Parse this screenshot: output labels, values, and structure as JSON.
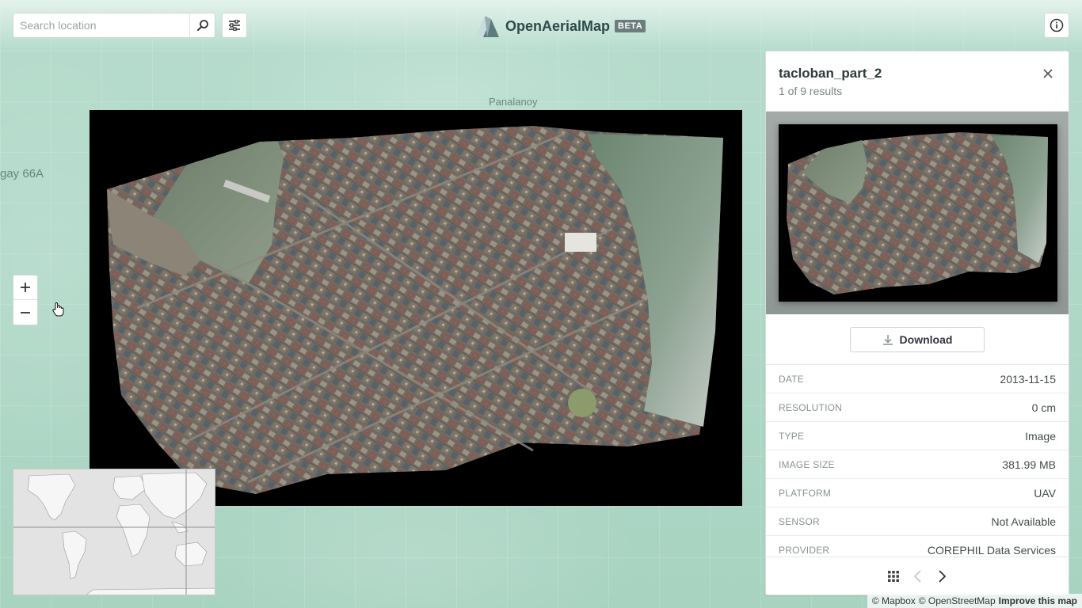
{
  "header": {
    "search": {
      "placeholder": "Search location",
      "value": ""
    },
    "brand": {
      "name": "OpenAerialMap",
      "badge": "BETA"
    }
  },
  "map": {
    "labels": [
      {
        "text": "Panalanoy"
      },
      {
        "text": "gay 66A"
      }
    ]
  },
  "panel": {
    "title": "tacloban_part_2",
    "subtitle": "1 of 9 results",
    "download_label": "Download",
    "metadata": [
      {
        "key": "DATE",
        "value": "2013-11-15"
      },
      {
        "key": "RESOLUTION",
        "value": "0 cm"
      },
      {
        "key": "TYPE",
        "value": "Image"
      },
      {
        "key": "IMAGE SIZE",
        "value": "381.99 MB"
      },
      {
        "key": "PLATFORM",
        "value": "UAV"
      },
      {
        "key": "SENSOR",
        "value": "Not Available"
      },
      {
        "key": "PROVIDER",
        "value": "COREPHIL Data Services"
      }
    ]
  },
  "attribution": {
    "mapbox": "© Mapbox",
    "osm": "© OpenStreetMap",
    "improve": "Improve this map"
  },
  "colors": {
    "map_bg": "#a9d4c2",
    "brand_text": "#2e4a4a",
    "beta_bg": "#6b7d7d"
  },
  "icons": {
    "search": "search-icon",
    "filter": "sliders-icon",
    "info": "info-icon",
    "close": "close-icon",
    "download": "download-icon",
    "grid": "grid-icon",
    "prev": "chevron-left-icon",
    "next": "chevron-right-icon"
  }
}
